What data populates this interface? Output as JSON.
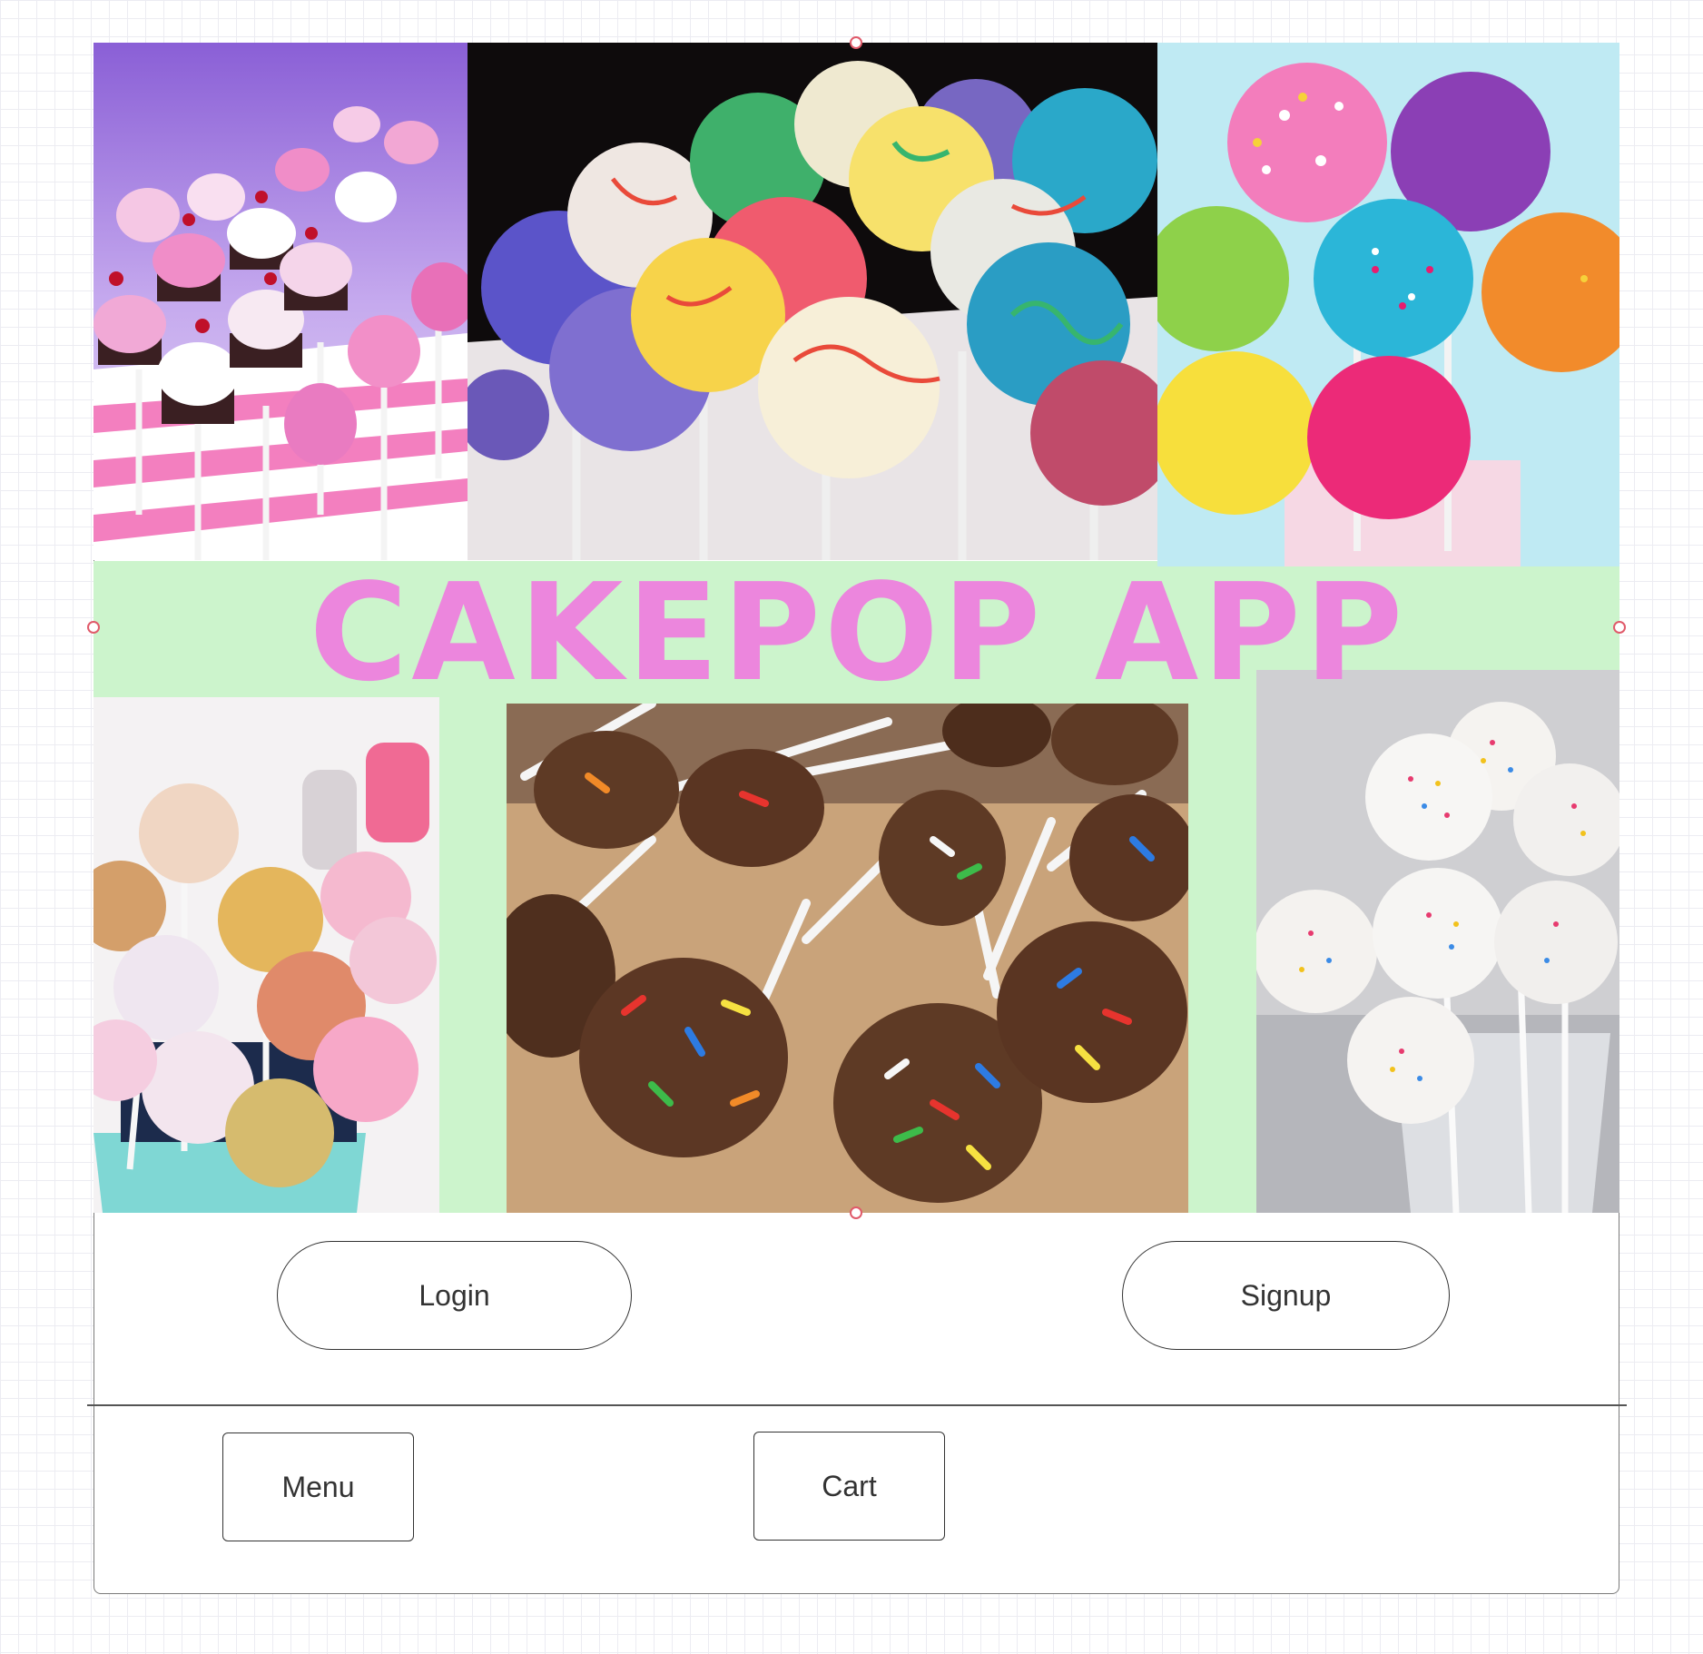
{
  "app": {
    "title": "CAKEPOP APP"
  },
  "auth": {
    "login_label": "Login",
    "signup_label": "Signup"
  },
  "nav": {
    "menu_label": "Menu",
    "cart_label": "Cart"
  },
  "colors": {
    "banner_bg": "#ccf4cc",
    "title_pink": "#ec86dd",
    "handle_red": "#e05a6a"
  },
  "images": [
    "cupcake-shaped cake pops on pink striped stand",
    "marbled colorful cake pops on dark background",
    "sprinkle-covered bright cake pops on light blue",
    "pastel sprinkle cake pops in bucket",
    "chocolate cake pops with rainbow sprinkles",
    "white cake pops with nonpareils in glass jar"
  ]
}
